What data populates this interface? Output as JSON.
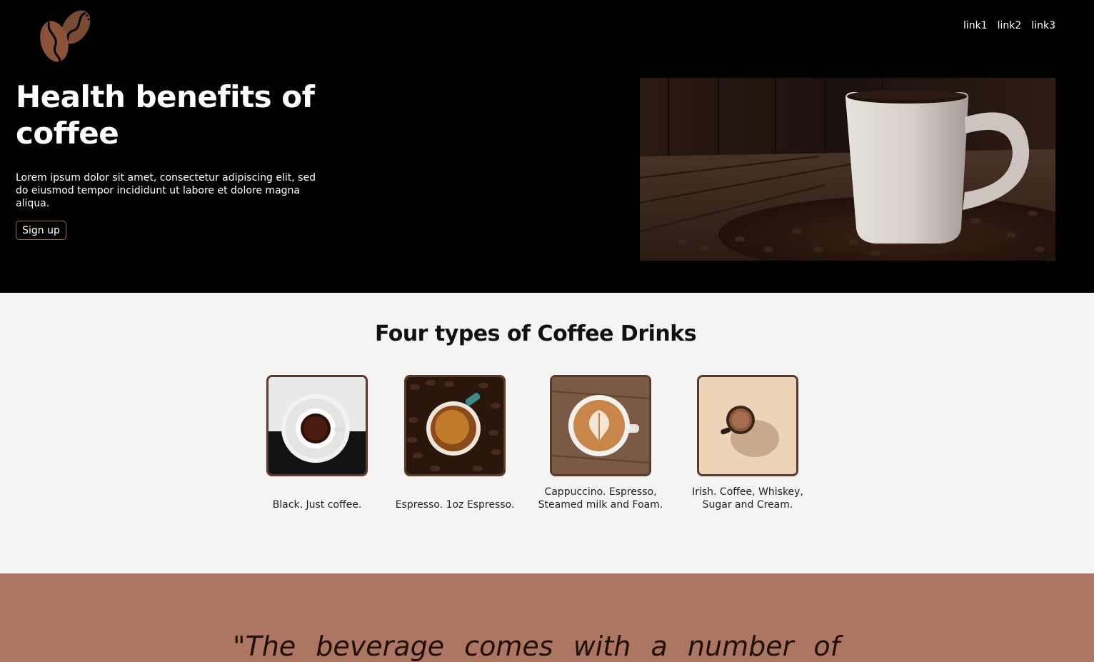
{
  "nav": {
    "links": [
      "link1",
      "link2",
      "link3"
    ]
  },
  "hero": {
    "logo_icon": "coffee-beans-icon",
    "title": "Health benefits of coffee",
    "text": "Lorem ipsum dolor sit amet, consectetur adipiscing elit, sed do eiusmod tempor incididunt ut labore et dolore magna aliqua.",
    "signup_label": "Sign up"
  },
  "types": {
    "title": "Four types of Coffee Drinks",
    "items": [
      {
        "caption": "Black. Just coffee."
      },
      {
        "caption": "Espresso. 1oz Espresso."
      },
      {
        "caption": "Cappuccino. Espresso, Steamed milk and Foam."
      },
      {
        "caption": "Irish. Coffee, Whiskey, Sugar and Cream."
      }
    ]
  },
  "quote": {
    "words": [
      "\"The",
      "beverage",
      "comes",
      "with",
      "a",
      "number",
      "of"
    ]
  },
  "colors": {
    "brand_brown": "#ac7660",
    "card_border": "#5a3a2c",
    "light_bg": "#f6f4f2"
  }
}
